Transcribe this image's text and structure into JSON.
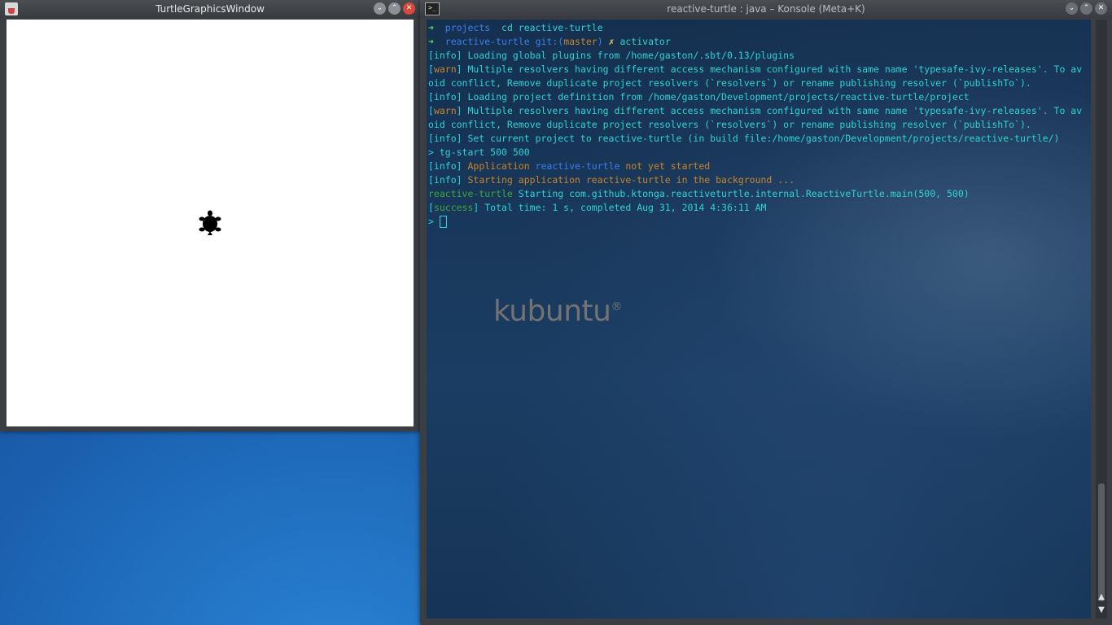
{
  "turtle_window": {
    "title": "TurtleGraphicsWindow",
    "buttons": [
      "⌄",
      "⌃",
      "✕"
    ]
  },
  "konsole": {
    "title": "reactive-turtle : java – Konsole (Meta+K)",
    "buttons": [
      "⌄",
      "⌃",
      "✕"
    ],
    "lines": [
      [
        {
          "t": "➜  ",
          "c": "c-green"
        },
        {
          "t": "projects",
          "c": "c-blue"
        },
        {
          "t": "  cd reactive-turtle",
          "c": ""
        }
      ],
      [
        {
          "t": "➜  ",
          "c": "c-green"
        },
        {
          "t": "reactive-turtle ",
          "c": "c-blue"
        },
        {
          "t": "git:(",
          "c": "c-blue"
        },
        {
          "t": "master",
          "c": "c-orange"
        },
        {
          "t": ") ",
          "c": "c-blue"
        },
        {
          "t": "✗ ",
          "c": "c-yellow"
        },
        {
          "t": "activator",
          "c": ""
        }
      ],
      [
        {
          "t": "[info] Loading global plugins from /home/gaston/.sbt/0.13/plugins",
          "c": ""
        }
      ],
      [
        {
          "t": "[",
          "c": ""
        },
        {
          "t": "warn",
          "c": "c-orange"
        },
        {
          "t": "] Multiple resolvers having different access mechanism configured with same name 'typesafe-ivy-releases'. To av",
          "c": ""
        }
      ],
      [
        {
          "t": "oid conflict, Remove duplicate project resolvers (`resolvers`) or rename publishing resolver (`publishTo`).",
          "c": ""
        }
      ],
      [
        {
          "t": "[info] Loading project definition from /home/gaston/Development/projects/reactive-turtle/project",
          "c": ""
        }
      ],
      [
        {
          "t": "[",
          "c": ""
        },
        {
          "t": "warn",
          "c": "c-orange"
        },
        {
          "t": "] Multiple resolvers having different access mechanism configured with same name 'typesafe-ivy-releases'. To av",
          "c": ""
        }
      ],
      [
        {
          "t": "oid conflict, Remove duplicate project resolvers (`resolvers`) or rename publishing resolver (`publishTo`).",
          "c": ""
        }
      ],
      [
        {
          "t": "[info] Set current project to reactive-turtle (in build file:/home/gaston/Development/projects/reactive-turtle/)",
          "c": ""
        }
      ],
      [
        {
          "t": "> tg-start 500 500",
          "c": ""
        }
      ],
      [
        {
          "t": "[info] ",
          "c": ""
        },
        {
          "t": "Application ",
          "c": "c-orange"
        },
        {
          "t": "reactive-turtle",
          "c": "c-blue"
        },
        {
          "t": " not yet started",
          "c": "c-orange"
        }
      ],
      [
        {
          "t": "[info] ",
          "c": ""
        },
        {
          "t": "Starting application reactive-turtle in the background ...",
          "c": "c-orange"
        }
      ],
      [
        {
          "t": "reactive-turtle ",
          "c": "c-gitgreen"
        },
        {
          "t": "Starting com.github.ktonga.reactiveturtle.internal.ReactiveTurtle.main(500, 500)",
          "c": ""
        }
      ],
      [
        {
          "t": "[",
          "c": ""
        },
        {
          "t": "success",
          "c": "c-gitgreen"
        },
        {
          "t": "] Total time: 1 s, completed Aug 31, 2014 4:36:11 AM",
          "c": ""
        }
      ],
      [
        {
          "t": "> ",
          "c": ""
        }
      ]
    ],
    "watermark": "kubuntu",
    "watermark_mark": "®"
  }
}
